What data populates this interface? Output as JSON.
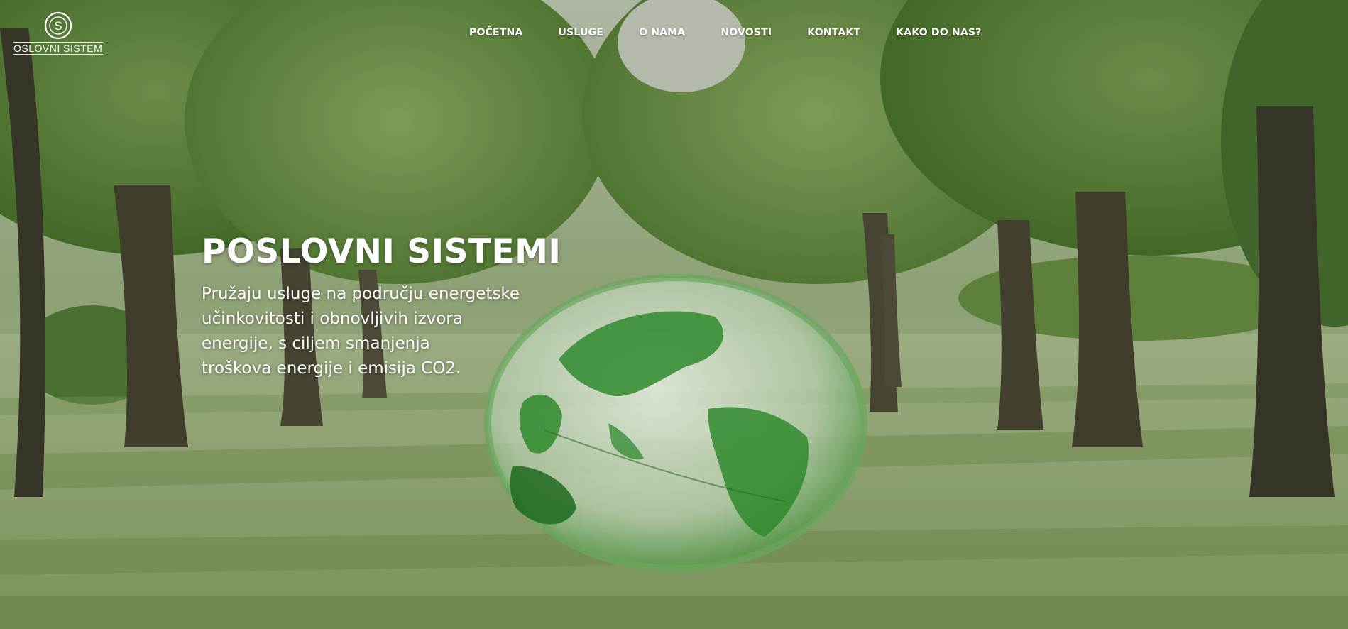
{
  "logo": {
    "monogram": "S",
    "text": "OSLOVNI SISTEMI"
  },
  "nav": {
    "items": [
      {
        "label": "POČETNA"
      },
      {
        "label": "USLUGE"
      },
      {
        "label": "O NAMA"
      },
      {
        "label": "NOVOSTI"
      },
      {
        "label": "KONTAKT"
      },
      {
        "label": "KAKO DO NAS?"
      }
    ]
  },
  "hero": {
    "title": "POSLOVNI SISTEMI",
    "lines": [
      "Pružaju usluge na području energetske",
      "učinkovitosti i obnovljivih izvora",
      "energije, s ciljem smanjenja",
      "troškova energije i emisija CO2."
    ],
    "background": "park-trees-with-green-globe"
  },
  "colors": {
    "text": "#ffffff",
    "foliage": "#5f8a3a",
    "grass": "#a9c27f",
    "globe": "#3d8f3a"
  }
}
